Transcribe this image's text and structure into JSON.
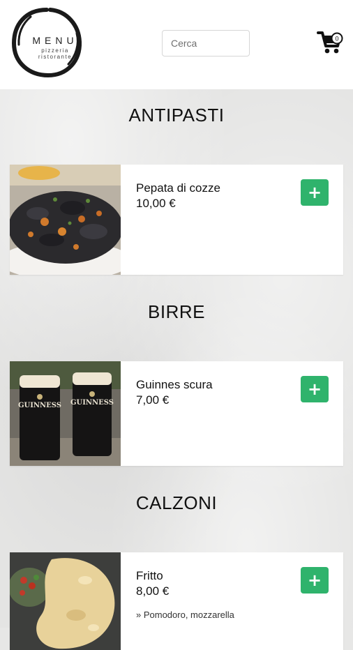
{
  "header": {
    "logo": {
      "word": "MENU",
      "line1": "pizzeria",
      "line2": "ristorante"
    },
    "search": {
      "placeholder": "Cerca",
      "value": ""
    },
    "cart": {
      "icon": "cart-icon",
      "count": "0"
    }
  },
  "sections": [
    {
      "title": "ANTIPASTI",
      "items": [
        {
          "name": "Pepata di cozze",
          "price": "10,00 €",
          "image": "mussels-dish",
          "add_label": "+"
        }
      ]
    },
    {
      "title": "BIRRE",
      "items": [
        {
          "name": "Guinnes scura",
          "price": "7,00 €",
          "image": "guinness-pints",
          "image_text": "GUINNESS",
          "add_label": "+"
        }
      ]
    },
    {
      "title": "CALZONI",
      "items": [
        {
          "name": "Fritto",
          "price": "8,00 €",
          "description": "» Pomodoro, mozzarella",
          "image": "fried-calzone",
          "add_label": "+"
        }
      ]
    }
  ],
  "colors": {
    "accent": "#2fb36c",
    "header_bg": "#ffffff",
    "page_bg": "#e4e4e3"
  }
}
